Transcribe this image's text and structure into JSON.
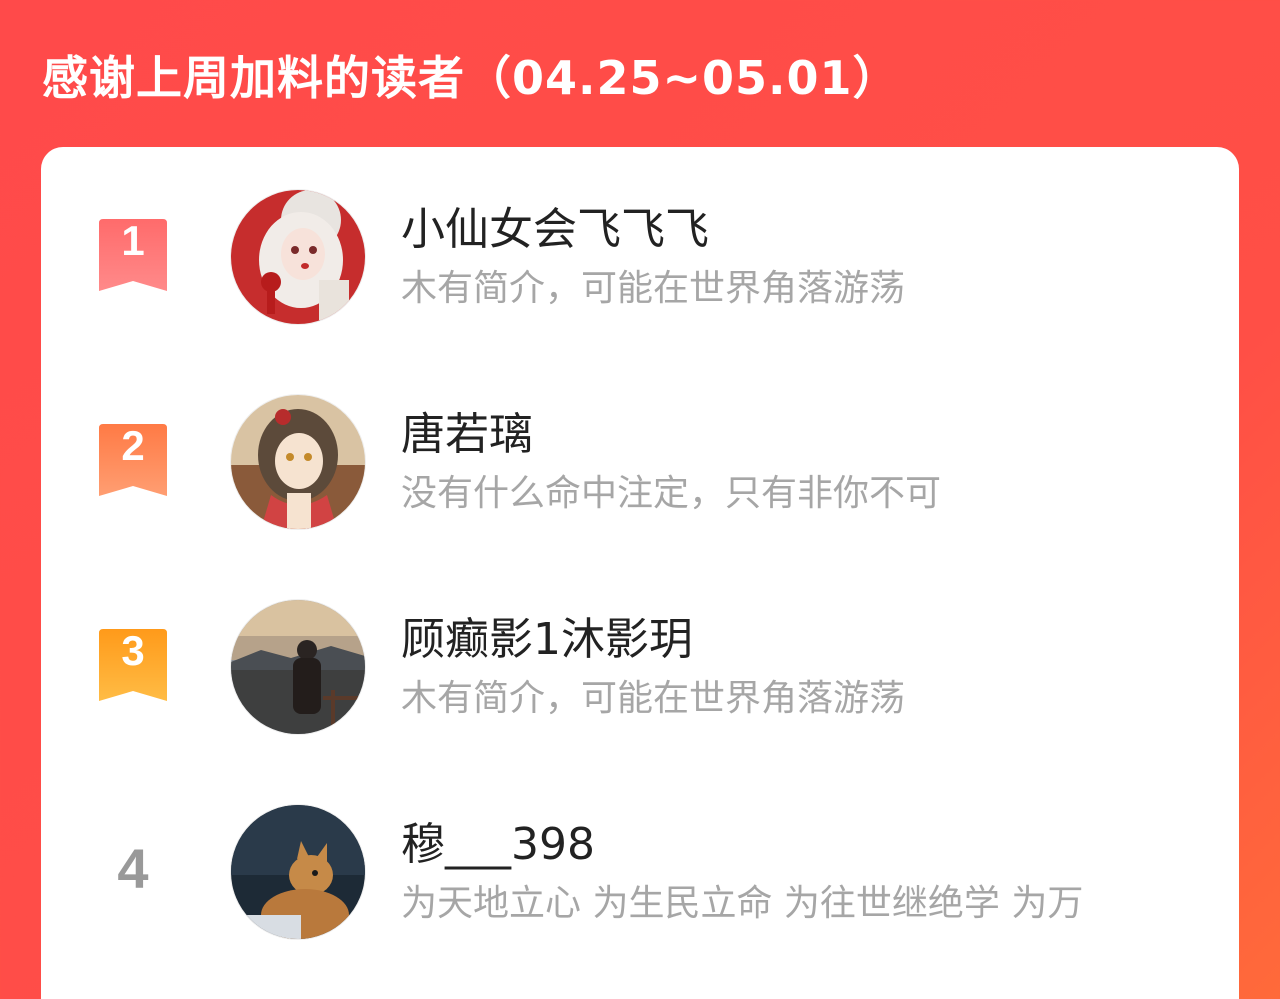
{
  "header": {
    "title": "感谢上周加料的读者（04.25~05.01）"
  },
  "colors": {
    "background": "#ff4a4a",
    "rank1": "#ff5a5a",
    "rank2": "#ff7d4f",
    "rank3": "#ffa31a",
    "rank_plain": "#999999",
    "name": "#222222",
    "bio": "#a6a6a6"
  },
  "readers": [
    {
      "rank": "1",
      "name": "小仙女会飞飞飞",
      "bio": "木有简介，可能在世界角落游荡",
      "avatar": "girl-illustration-avatar"
    },
    {
      "rank": "2",
      "name": "唐若璃",
      "bio": "没有什么命中注定，只有非你不可",
      "avatar": "anime-girl-avatar"
    },
    {
      "rank": "3",
      "name": "顾癫影1沐影玥",
      "bio": "木有简介，可能在世界角落游荡",
      "avatar": "person-landscape-avatar"
    },
    {
      "rank": "4",
      "name": "穆___398",
      "bio": "为天地立心 为生民立命 为往世继绝学 为万",
      "avatar": "cat-avatar"
    }
  ]
}
